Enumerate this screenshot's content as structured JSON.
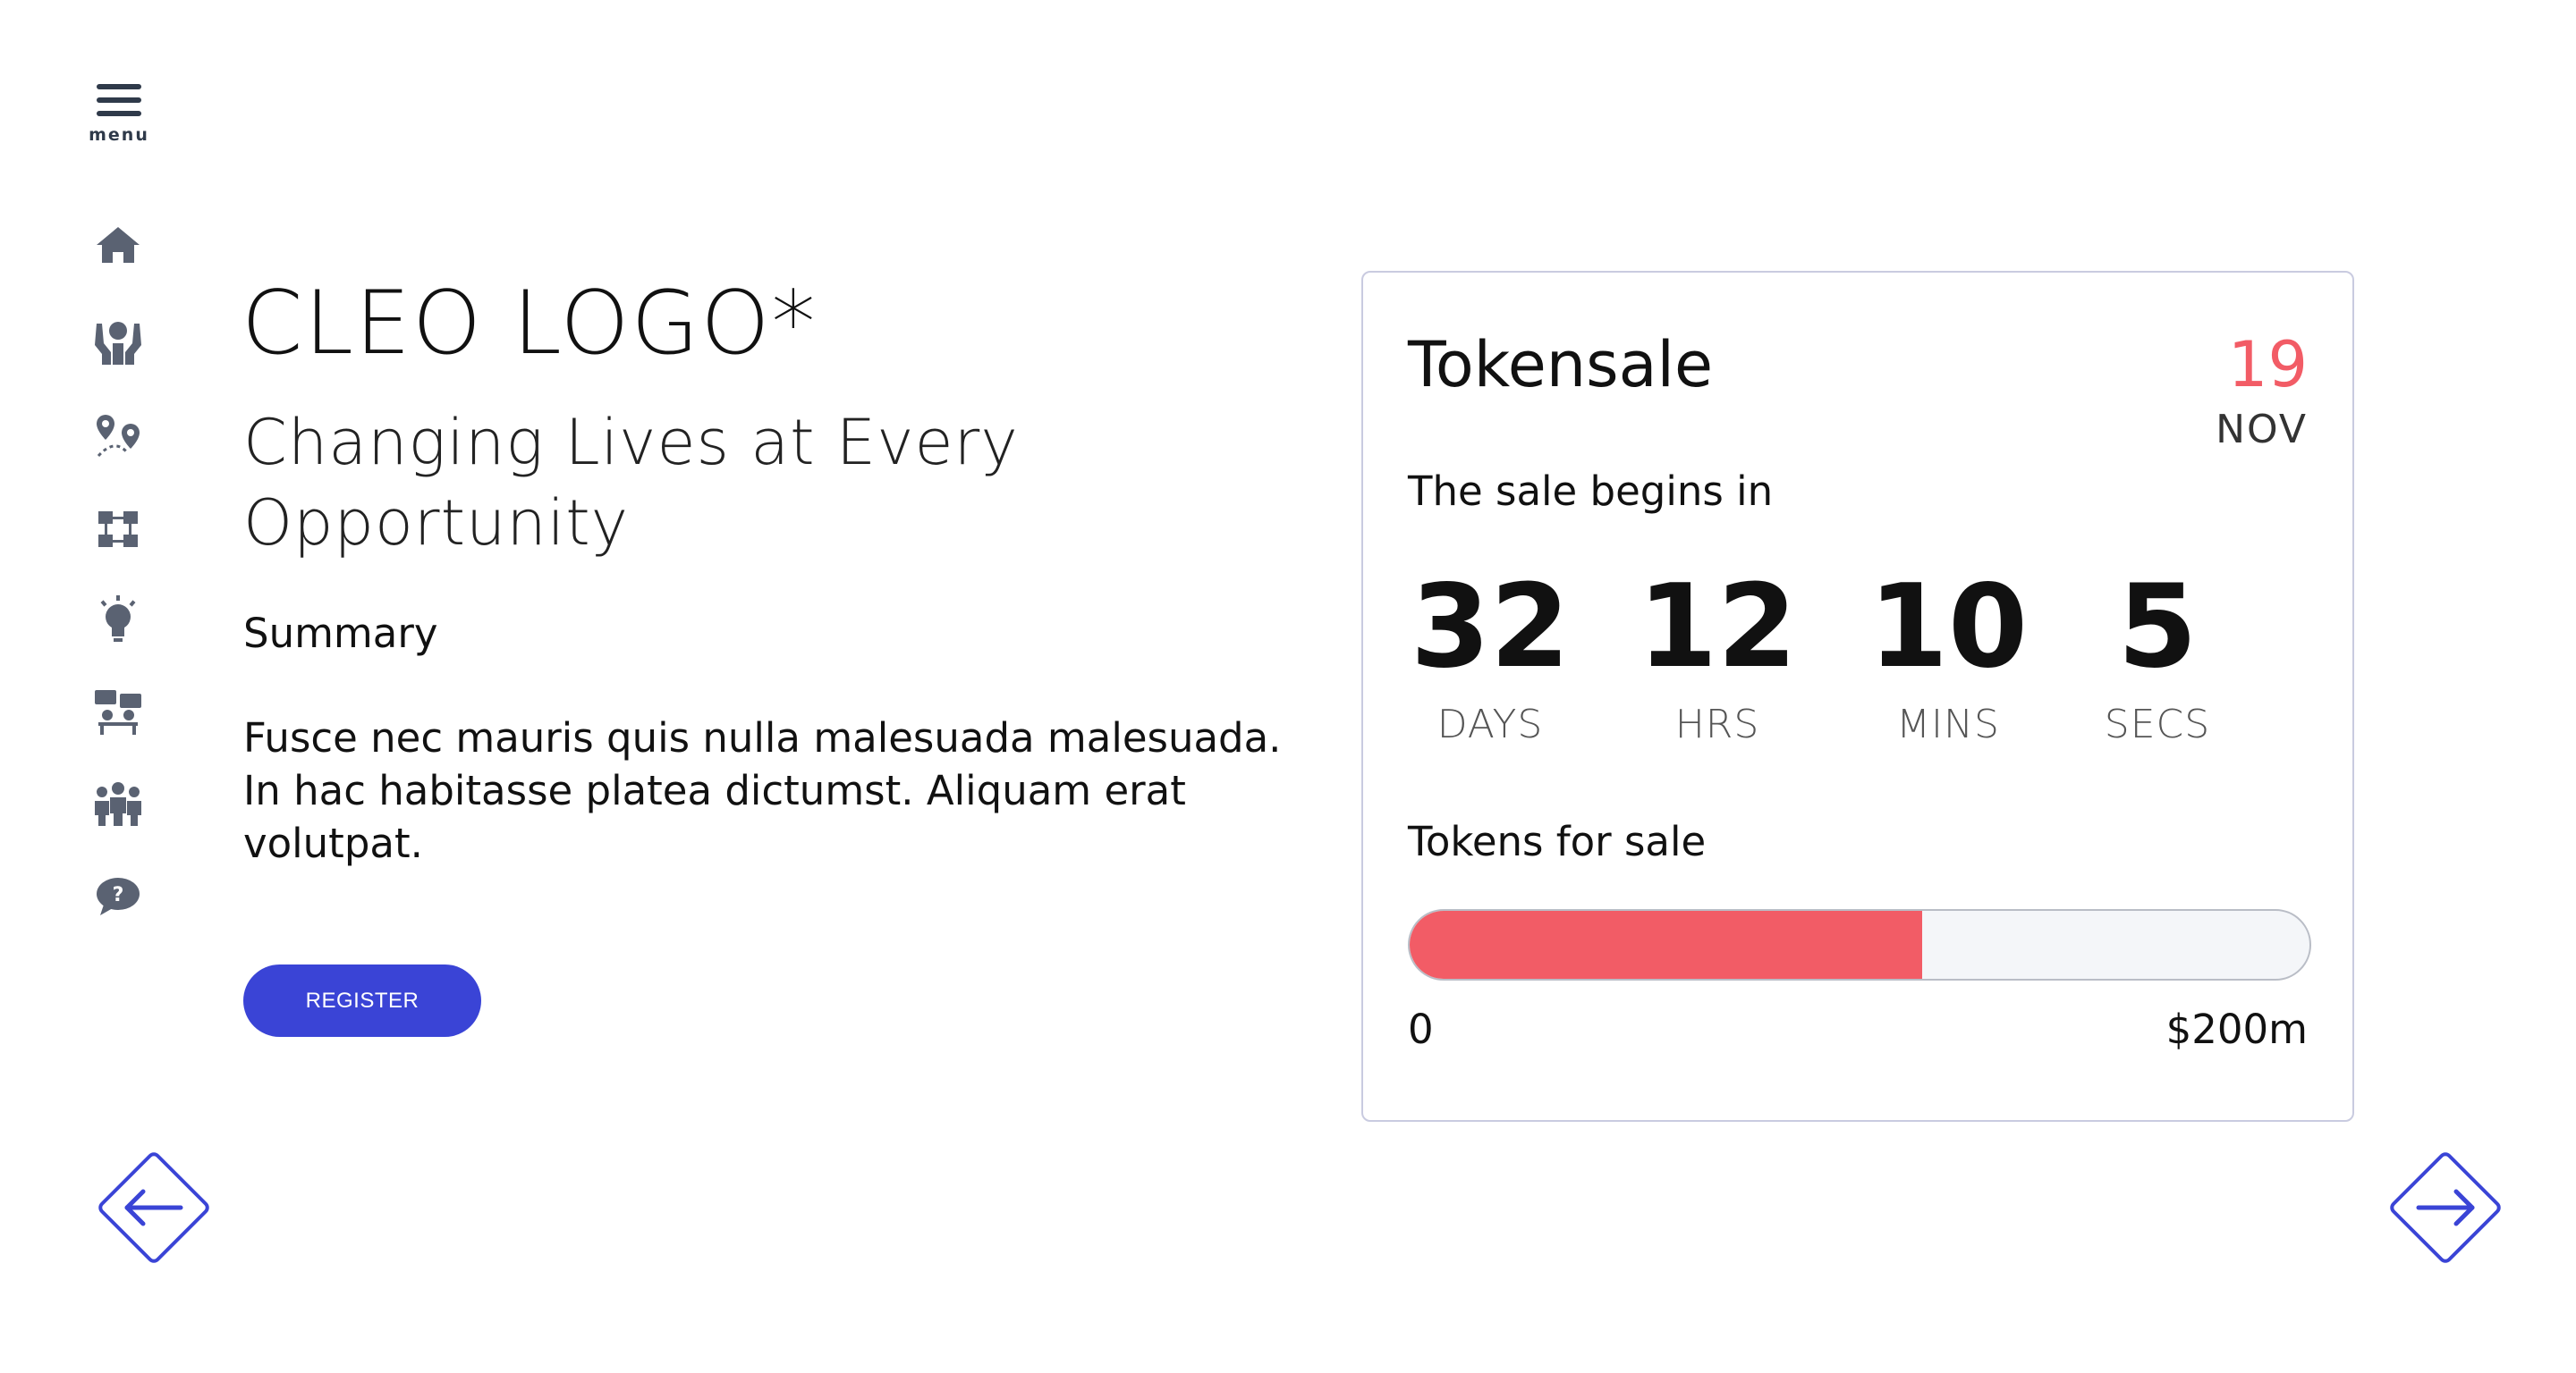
{
  "sidebar": {
    "menu_label": "menu",
    "items": [
      {
        "icon": "home-icon"
      },
      {
        "icon": "hands-icon"
      },
      {
        "icon": "roadmap-icon"
      },
      {
        "icon": "network-icon"
      },
      {
        "icon": "lightbulb-icon"
      },
      {
        "icon": "presentation-icon"
      },
      {
        "icon": "team-icon"
      },
      {
        "icon": "help-chat-icon"
      }
    ]
  },
  "hero": {
    "logo": "CLEO LOGO*",
    "tagline": "Changing Lives at Every Opportunity",
    "summary_title": "Summary",
    "summary_text": "Fusce nec mauris quis nulla malesuada malesuada. In hac habitasse platea dictumst. Aliquam erat volutpat.",
    "register_label": "REGISTER"
  },
  "tokensale": {
    "title": "Tokensale",
    "date_day": "19",
    "date_month": "NOV",
    "begins_label": "The sale begins in",
    "countdown": [
      {
        "value": "32",
        "label": "DAYS"
      },
      {
        "value": "12",
        "label": "HRS"
      },
      {
        "value": "10",
        "label": "MINS"
      },
      {
        "value": "5",
        "label": "SECS"
      }
    ],
    "tokens_label": "Tokens for sale",
    "progress_fraction": 0.57,
    "range_min": "0",
    "range_max": "$200m"
  },
  "colors": {
    "accent": "#3a44d6",
    "highlight": "#f25c66",
    "icon_gray": "#5a6272"
  },
  "nav": {
    "prev_icon": "arrow-left-icon",
    "next_icon": "arrow-right-icon"
  }
}
